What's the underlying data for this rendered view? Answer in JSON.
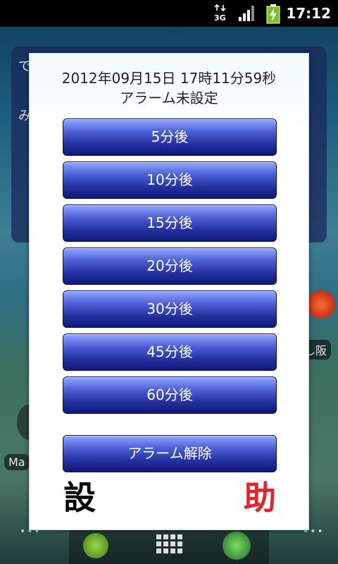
{
  "status_bar": {
    "network": "3G",
    "time": "17:12"
  },
  "background": {
    "widget_glyph_1": "で",
    "widget_glyph_2": "み",
    "left_label": "Ma",
    "right_label": "し阪"
  },
  "dialog": {
    "datetime": "2012年09月15日  17時11分59秒",
    "status": "アラーム未設定",
    "buttons": [
      "5分後",
      "10分後",
      "15分後",
      "20分後",
      "30分後",
      "45分後",
      "60分後"
    ],
    "cancel_button": "アラーム解除",
    "left_kanji": "設",
    "right_kanji": "助"
  },
  "colors": {
    "right_kanji": "#e8222a",
    "left_kanji": "#000000",
    "button_top": "#95a8ff",
    "button_bottom": "#101979"
  }
}
